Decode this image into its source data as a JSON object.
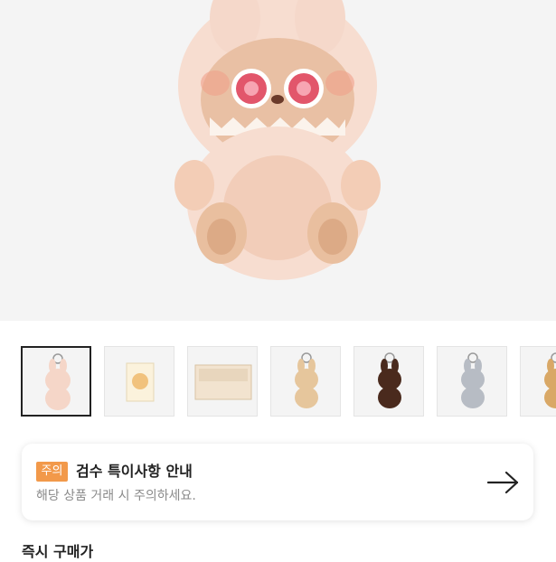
{
  "hero": {
    "image": "labubu-pink-plush-figure"
  },
  "thumbnails": [
    {
      "image": "pink-plush-keychain",
      "selected": true
    },
    {
      "image": "blind-box-package",
      "selected": false
    },
    {
      "image": "display-box-set",
      "selected": false
    },
    {
      "image": "beige-plush-keychain",
      "selected": false
    },
    {
      "image": "brown-plush-keychain",
      "selected": false
    },
    {
      "image": "gray-plush-keychain",
      "selected": false
    },
    {
      "image": "tan-plush-keychain",
      "selected": false
    }
  ],
  "notice": {
    "badge": "주의",
    "title": "검수 특이사항 안내",
    "subtitle": "해당 상품 거래 시 주의하세요.",
    "arrow_icon": "arrow-right-icon"
  },
  "section": {
    "label": "즉시 구매가"
  },
  "colors": {
    "badge": "#f2994a",
    "accent_text": "#222222",
    "muted_text": "#8a8a8a"
  }
}
